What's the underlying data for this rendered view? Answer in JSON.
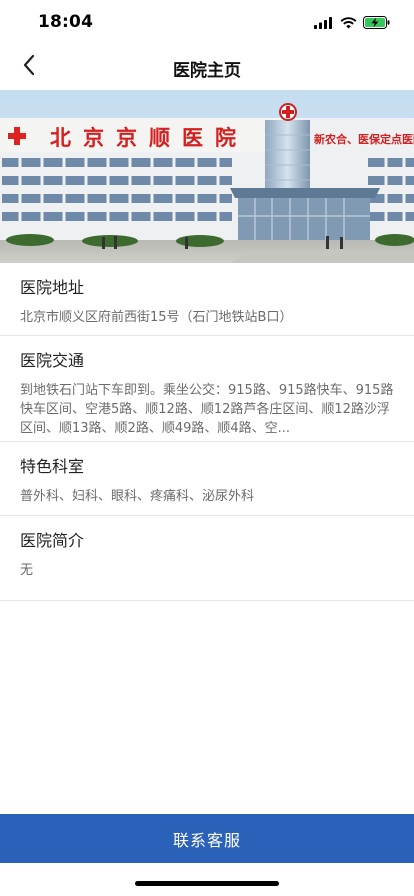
{
  "status_bar": {
    "time": "18:04",
    "icons": [
      "signal-icon",
      "wifi-icon",
      "battery-charging-icon"
    ]
  },
  "nav": {
    "back_icon": "chevron-left-icon",
    "title": "医院主页"
  },
  "banner": {
    "hospital_name": "北京京顺医院",
    "slogan": "新农合、医保定点医院"
  },
  "sections": [
    {
      "title": "医院地址",
      "body": "北京市顺义区府前西街15号（石门地铁站B口）"
    },
    {
      "title": "医院交通",
      "body": "到地铁石门站下车即到。乘坐公交：915路、915路快车、915路快车区间、空港5路、顺12路、顺12路芦各庄区间、顺12路沙浮区间、顺13路、顺2路、顺49路、顺4路、空..."
    },
    {
      "title": "特色科室",
      "body": "普外科、妇科、眼科、疼痛科、泌尿外科"
    },
    {
      "title": "医院简介",
      "body": "无"
    }
  ],
  "contact_button": {
    "label": "联系客服"
  },
  "colors": {
    "primary": "#2a62b9",
    "divider": "#e6e6e6",
    "text_secondary": "#6b6b6b"
  }
}
